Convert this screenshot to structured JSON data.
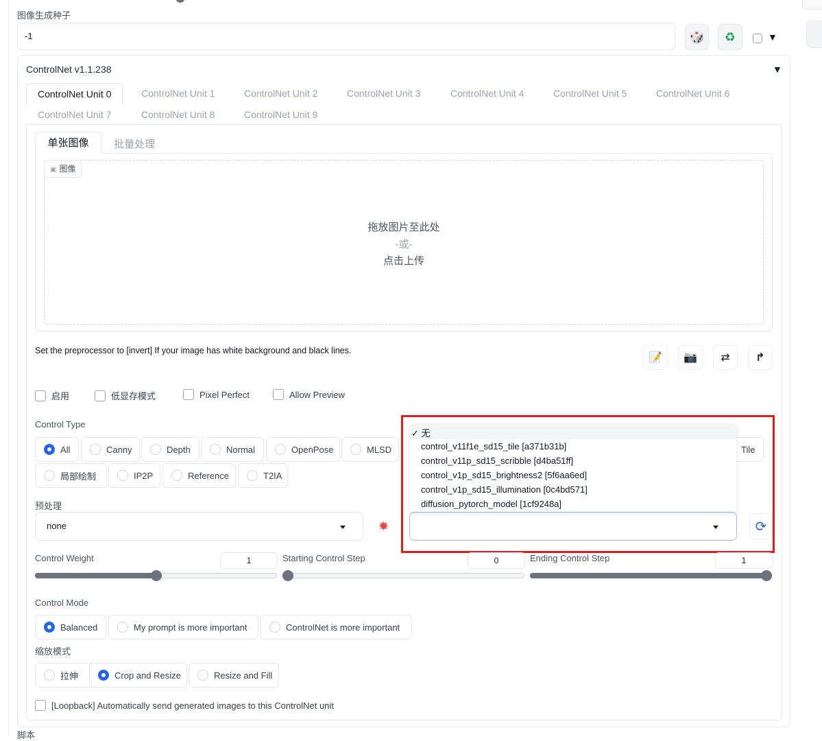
{
  "seed": {
    "label": "图像生成种子",
    "value": "-1",
    "dice_icon": "dice-icon",
    "recycle_icon": "recycle-icon"
  },
  "controlnet": {
    "title": "ControlNet v1.1.238",
    "collapse_glyph": "▼",
    "tabs": [
      "ControlNet Unit 0",
      "ControlNet Unit 1",
      "ControlNet Unit 2",
      "ControlNet Unit 3",
      "ControlNet Unit 4",
      "ControlNet Unit 5",
      "ControlNet Unit 6",
      "ControlNet Unit 7",
      "ControlNet Unit 8",
      "ControlNet Unit 9"
    ],
    "subtabs": [
      "单张图像",
      "批量处理"
    ],
    "image_label": "图像",
    "drop": {
      "line1": "拖放图片至此处",
      "line2": "-或-",
      "line3": "点击上传"
    },
    "hint": "Set the preprocessor to [invert] If your image has white background and black lines.",
    "checkboxes": [
      "启用",
      "低显存模式",
      "Pixel Perfect",
      "Allow Preview"
    ],
    "control_type_label": "Control Type",
    "control_types_row1": [
      "All",
      "Canny",
      "Depth",
      "Normal",
      "OpenPose",
      "MLSD"
    ],
    "control_type_extra": "Tile",
    "control_types_row2": [
      "局部绘制",
      "IP2P",
      "Reference",
      "T2IA"
    ],
    "control_type_selected": "All",
    "preprocessor_label": "预处理",
    "preprocessor_value": "none",
    "model_dropdown": {
      "checked_glyph": "✓",
      "options": [
        "无",
        "control_v11f1e_sd15_tile [a371b31b]",
        "control_v11p_sd15_scribble [d4ba51ff]",
        "control_v1p_sd15_brightness2 [5f6aa6ed]",
        "control_v1p_sd15_illumination [0c4bd571]",
        "diffusion_pytorch_model [1cf9248a]"
      ],
      "selected": "无"
    },
    "sliders": {
      "weight": {
        "label": "Control Weight",
        "value": "1",
        "fraction": 0.5
      },
      "start": {
        "label": "Starting Control Step",
        "value": "0",
        "fraction": 0
      },
      "end": {
        "label": "Ending Control Step",
        "value": "1",
        "fraction": 1
      }
    },
    "control_mode_label": "Control Mode",
    "control_modes": [
      "Balanced",
      "My prompt is more important",
      "ControlNet is more important"
    ],
    "control_mode_selected": "Balanced",
    "resize_label": "缩放模式",
    "resize_modes": [
      "拉伸",
      "Crop and Resize",
      "Resize and Fill"
    ],
    "resize_selected": "Crop and Resize",
    "loopback": "[Loopback] Automatically send generated images to this ControlNet unit"
  },
  "script_label": "脚本",
  "tool_icons": [
    "edit-icon",
    "camera-icon",
    "swap-icon",
    "upload-arrow-icon"
  ]
}
